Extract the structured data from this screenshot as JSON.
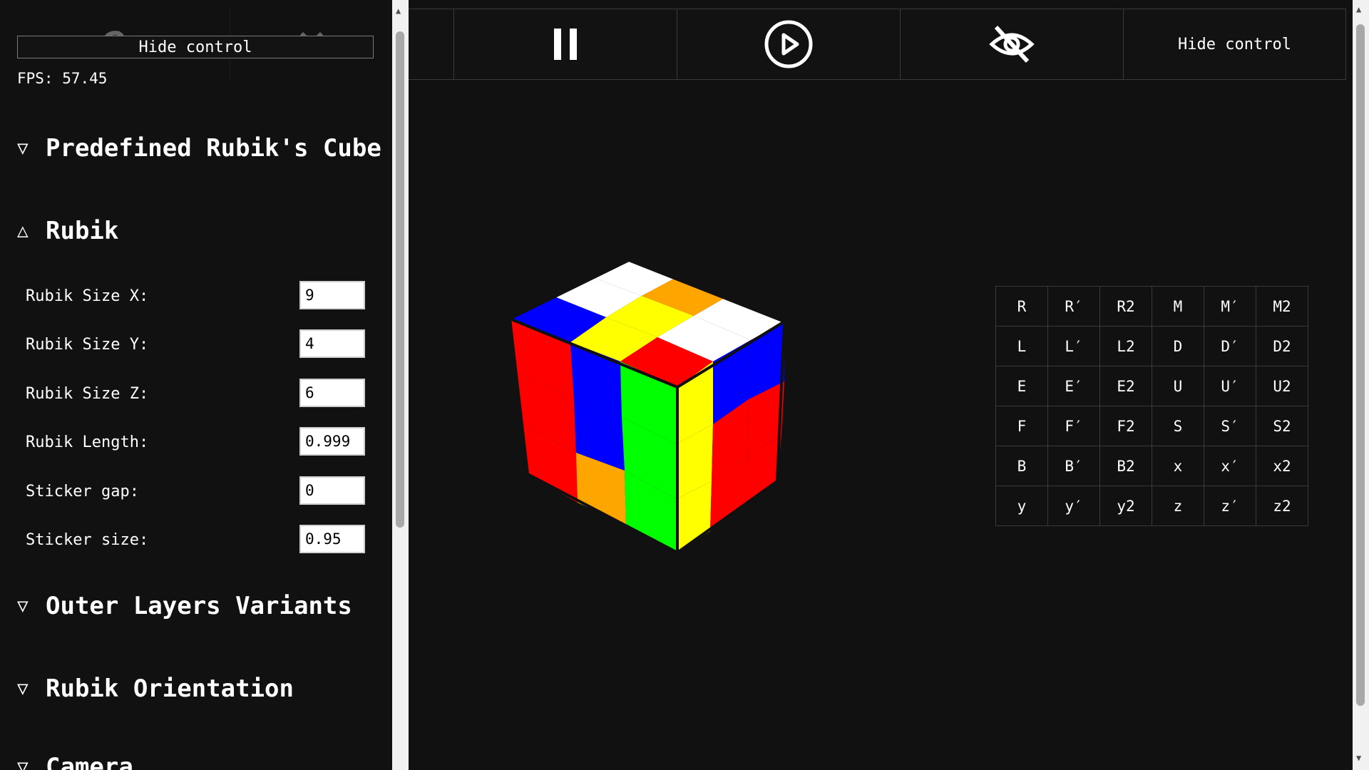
{
  "toolbar": {
    "hide_control_label": "Hide control",
    "buttons": [
      {
        "icon": "pause-icon"
      },
      {
        "icon": "play-circle-icon"
      },
      {
        "icon": "eye-off-icon"
      }
    ]
  },
  "panel": {
    "hide_control_label": "Hide control",
    "fps": "FPS: 57.45",
    "ghost_icons": [
      "reset-icon",
      "tools-icon"
    ],
    "sections": {
      "predefined": "Predefined Rubik's Cube",
      "rubik": "Rubik",
      "outer_layers": "Outer Layers Variants",
      "orientation": "Rubik Orientation",
      "camera": "Camera"
    },
    "fields": [
      {
        "label": "Rubik Size X:",
        "value": "9"
      },
      {
        "label": "Rubik Size Y:",
        "value": "4"
      },
      {
        "label": "Rubik Size Z:",
        "value": "6"
      },
      {
        "label": "Rubik Length:",
        "value": "0.999"
      },
      {
        "label": "Sticker gap:",
        "value": "0"
      },
      {
        "label": "Sticker size:",
        "value": "0.95"
      }
    ]
  },
  "moves": [
    "R",
    "R′",
    "R2",
    "M",
    "M′",
    "M2",
    "L",
    "L′",
    "L2",
    "D",
    "D′",
    "D2",
    "E",
    "E′",
    "E2",
    "U",
    "U′",
    "U2",
    "F",
    "F′",
    "F2",
    "S",
    "S′",
    "S2",
    "B",
    "B′",
    "B2",
    "x",
    "x′",
    "x2",
    "y",
    "y′",
    "y2",
    "z",
    "z′",
    "z2"
  ],
  "colors": {
    "background": "#111111",
    "white": "#ffffff",
    "yellow": "#ffff00",
    "red": "#ff0000",
    "green": "#00ff00",
    "blue": "#0000ff",
    "orange": "#ffa500"
  }
}
